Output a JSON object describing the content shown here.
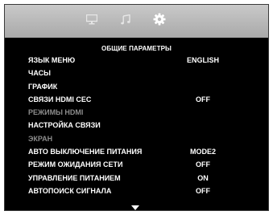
{
  "tabs": [
    {
      "icon": "monitor-icon",
      "active": false
    },
    {
      "icon": "music-note-icon",
      "active": false
    },
    {
      "icon": "gear-icon",
      "active": true
    }
  ],
  "menu": {
    "title": "ОБЩИЕ ПАРАМЕТРЫ",
    "items": [
      {
        "label": "ЯЗЫК МЕНЮ",
        "value": "ENGLISH",
        "enabled": true
      },
      {
        "label": "ЧАСЫ",
        "value": "",
        "enabled": true
      },
      {
        "label": "ГРАФИК",
        "value": "",
        "enabled": true
      },
      {
        "label": "СВЯЗИ HDMI CEC",
        "value": "OFF",
        "enabled": true
      },
      {
        "label": "РЕЖИМЫ HDMI",
        "value": "",
        "enabled": false
      },
      {
        "label": "НАСТРОЙКА СВЯЗИ",
        "value": "",
        "enabled": true
      },
      {
        "label": "ЭКРАН",
        "value": "",
        "enabled": false
      },
      {
        "label": "АВТО ВЫКЛЮЧЕНИЕ ПИТАНИЯ",
        "value": "MODE2",
        "enabled": true
      },
      {
        "label": "РЕЖИМ ОЖИДАНИЯ СЕТИ",
        "value": "OFF",
        "enabled": true
      },
      {
        "label": "УПРАВЛЕНИЕ ПИТАНИЕМ",
        "value": "ON",
        "enabled": true
      },
      {
        "label": "АВТОПОИСК СИГНАЛА",
        "value": "OFF",
        "enabled": true
      }
    ]
  },
  "colors": {
    "background": "#000000",
    "text": "#ffffff",
    "disabled_text": "#8c8c8c",
    "tab_bar": "#b9b9b9"
  }
}
